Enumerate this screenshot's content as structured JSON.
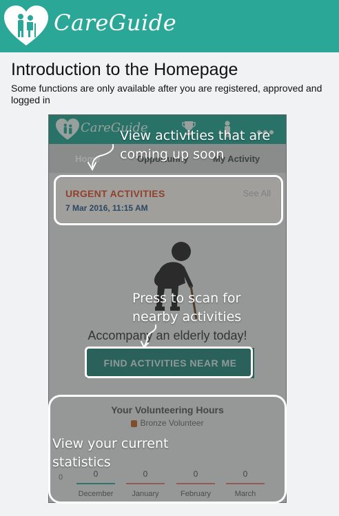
{
  "header": {
    "brand": "CareGuide",
    "logo_icon": "heart-caregiver-icon",
    "color": "#2aa796"
  },
  "intro": {
    "title": "Introduction to the Homepage",
    "subtitle": "Some functions are only available after you are registered, approved and logged in"
  },
  "phone": {
    "brand": "CareGuide",
    "icons": [
      "trophy-icon",
      "person-icon",
      "more-icon"
    ],
    "tabs": [
      {
        "label": "Home",
        "active": true
      },
      {
        "label": "Opportunity",
        "active": false
      },
      {
        "label": "My Activity",
        "active": false
      }
    ],
    "urgent": {
      "title": "URGENT ACTIVITIES",
      "date": "7 Mar 2016, 11:15 AM",
      "see_all": "See All"
    },
    "accompany_text": "Accompany an elderly today!",
    "find_button": "FIND ACTIVITIES NEAR ME",
    "hours": {
      "title": "Your Volunteering Hours",
      "badge": "Bronze Volunteer",
      "axis_zero": "0",
      "months": [
        {
          "name": "December",
          "value": "0",
          "color": "#3aa9a0"
        },
        {
          "name": "January",
          "value": "0",
          "color": "#e07a7a"
        },
        {
          "name": "February",
          "value": "0",
          "color": "#e07a7a"
        },
        {
          "name": "March",
          "value": "0",
          "color": "#e07a7a"
        }
      ]
    }
  },
  "annotations": {
    "upcoming": "View activities that are coming up soon",
    "scan": "Press to scan for nearby activities",
    "stats": "View your current statistics"
  }
}
